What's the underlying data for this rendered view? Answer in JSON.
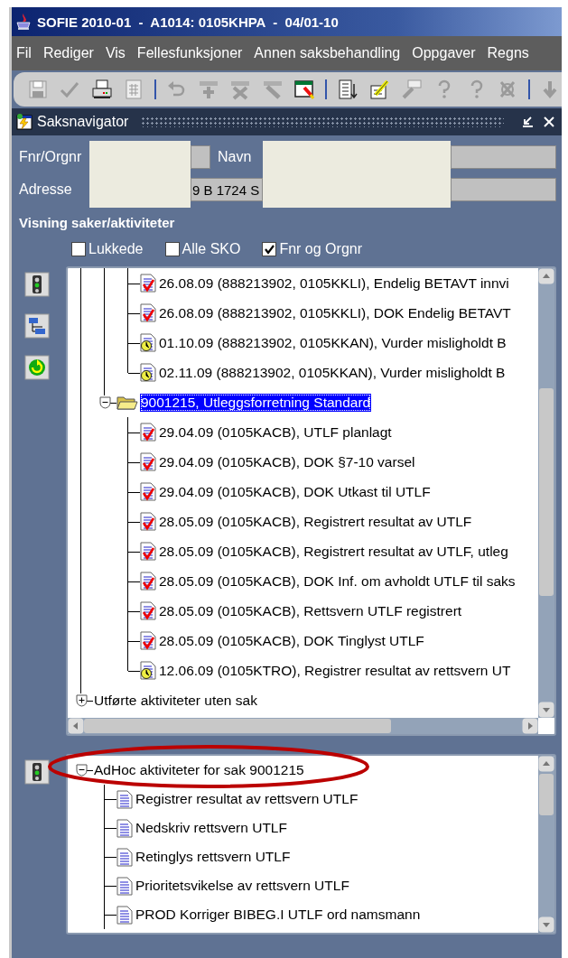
{
  "window": {
    "title": "SOFIE 2010-01  -  A1014: 0105KHPA  -  04/01-10"
  },
  "menu": [
    "Fil",
    "Rediger",
    "Vis",
    "Fellesfunksjoner",
    "Annen saksbehandling",
    "Oppgaver",
    "Regns"
  ],
  "toolbar": [
    {
      "kind": "save",
      "disabled": true
    },
    {
      "kind": "check",
      "disabled": true
    },
    {
      "kind": "print",
      "disabled": false
    },
    {
      "kind": "calculator",
      "disabled": true
    },
    {
      "kind": "separator"
    },
    {
      "kind": "undo",
      "disabled": true
    },
    {
      "kind": "insert",
      "disabled": true
    },
    {
      "kind": "delete",
      "disabled": true
    },
    {
      "kind": "edit",
      "disabled": true
    },
    {
      "kind": "window",
      "disabled": false
    },
    {
      "kind": "separator"
    },
    {
      "kind": "list",
      "disabled": false
    },
    {
      "kind": "note",
      "disabled": false
    },
    {
      "kind": "brush",
      "disabled": true
    },
    {
      "kind": "help",
      "disabled": true
    },
    {
      "kind": "help",
      "disabled": true
    },
    {
      "kind": "cross",
      "disabled": true
    },
    {
      "kind": "separator"
    },
    {
      "kind": "down",
      "disabled": true
    }
  ],
  "navigator": {
    "title": "Saksnavigator",
    "fields": [
      {
        "label": "Fnr/Orgnr"
      },
      {
        "label": "Navn"
      },
      {
        "label": "Adresse",
        "value": "9 B 1724 S"
      }
    ],
    "section_title": "Visning saker/aktiviteter",
    "filters": [
      {
        "label": "Lukkede",
        "checked": false
      },
      {
        "label": "Alle SKO",
        "checked": false
      },
      {
        "label": "Fnr og Orgnr",
        "checked": true
      }
    ],
    "case_tree": {
      "items_above": [
        {
          "label": "26.08.09 (888213902, 0105KKLI), Endelig BETAVT innvi",
          "kind": "done",
          "selected": false
        },
        {
          "label": "26.08.09 (888213902, 0105KKLI), DOK Endelig BETAVT",
          "kind": "done",
          "selected": false
        },
        {
          "label": "01.10.09 (888213902, 0105KKAN), Vurder misligholdt B",
          "kind": "pending",
          "selected": false
        },
        {
          "label": "02.11.09 (888213902, 0105KKAN), Vurder misligholdt B",
          "kind": "pending",
          "selected": false
        }
      ],
      "nodes": [
        {
          "kind": "case",
          "label": "9001215, Utleggsforretning Standard",
          "expanded": true,
          "selected": true,
          "children": [
            {
              "label": "29.04.09 (0105KACB), UTLF planlagt",
              "kind": "done",
              "selected": false
            },
            {
              "label": "29.04.09 (0105KACB), DOK §7-10 varsel",
              "kind": "done",
              "selected": false
            },
            {
              "label": "29.04.09 (0105KACB), DOK Utkast til UTLF",
              "kind": "done",
              "selected": false
            },
            {
              "label": "28.05.09 (0105KACB), Registrert resultat av UTLF",
              "kind": "done",
              "selected": false
            },
            {
              "label": "28.05.09 (0105KACB), Registrert resultat av UTLF, utleg",
              "kind": "done",
              "selected": false
            },
            {
              "label": "28.05.09 (0105KACB), DOK Inf. om avholdt UTLF til saks",
              "kind": "done",
              "selected": false
            },
            {
              "label": "28.05.09 (0105KACB), Rettsvern UTLF registrert",
              "kind": "done",
              "selected": false
            },
            {
              "label": "28.05.09 (0105KACB), DOK Tinglyst UTLF",
              "kind": "done",
              "selected": false
            },
            {
              "label": "12.06.09 (0105KTRO), Registrer resultat av rettsvern UT",
              "kind": "pending",
              "selected": false
            }
          ]
        },
        {
          "kind": "group",
          "label": "Utførte aktiviteter uten sak",
          "expanded": false,
          "selected": false
        }
      ]
    },
    "adhoc_tree": {
      "label": "AdHoc aktiviteter for sak 9001215",
      "expanded": true,
      "selected": false,
      "children": [
        {
          "label": "Registrer resultat av rettsvern UTLF",
          "selected": false
        },
        {
          "label": "Nedskriv rettsvern UTLF",
          "selected": false
        },
        {
          "label": "Retinglys rettsvern UTLF",
          "selected": false
        },
        {
          "label": "Prioritetsvikelse av rettsvern UTLF",
          "selected": false
        },
        {
          "label": "PROD Korriger BIBEG.I UTLF ord namsmann",
          "selected": false
        }
      ]
    }
  }
}
